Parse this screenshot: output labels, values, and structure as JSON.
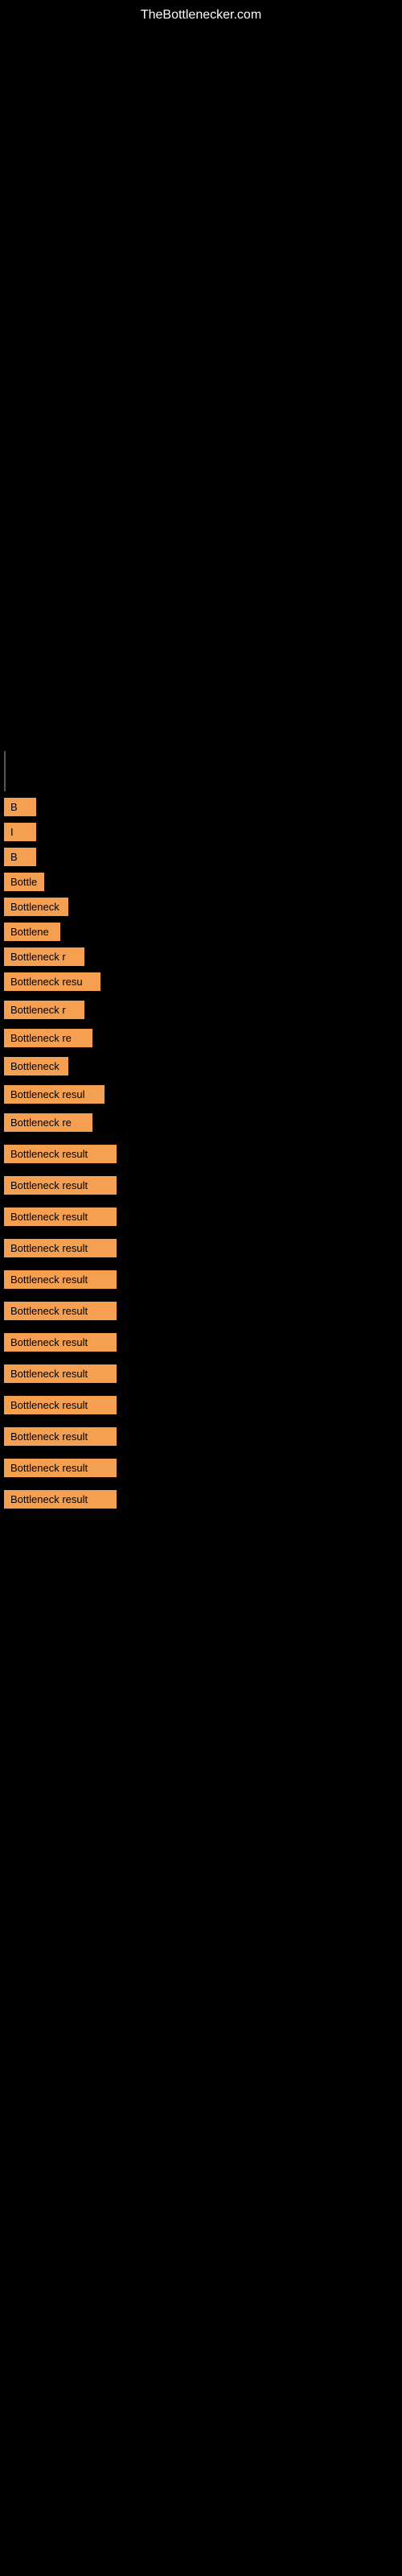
{
  "site": {
    "title": "TheBottlenecker.com"
  },
  "items": [
    {
      "id": 1,
      "label": "B",
      "width": 40
    },
    {
      "id": 2,
      "label": "I",
      "width": 40
    },
    {
      "id": 3,
      "label": "B",
      "width": 40
    },
    {
      "id": 4,
      "label": "Bottle",
      "width": 50
    },
    {
      "id": 5,
      "label": "Bottleneck",
      "width": 80
    },
    {
      "id": 6,
      "label": "Bottlene",
      "width": 70
    },
    {
      "id": 7,
      "label": "Bottleneck r",
      "width": 100
    },
    {
      "id": 8,
      "label": "Bottleneck resu",
      "width": 120
    },
    {
      "id": 9,
      "label": "Bottleneck r",
      "width": 100
    },
    {
      "id": 10,
      "label": "Bottleneck re",
      "width": 110
    },
    {
      "id": 11,
      "label": "Bottleneck",
      "width": 80
    },
    {
      "id": 12,
      "label": "Bottleneck resul",
      "width": 125
    },
    {
      "id": 13,
      "label": "Bottleneck re",
      "width": 110
    },
    {
      "id": 14,
      "label": "Bottleneck result",
      "width": 140
    },
    {
      "id": 15,
      "label": "Bottleneck result",
      "width": 140
    },
    {
      "id": 16,
      "label": "Bottleneck result",
      "width": 140
    },
    {
      "id": 17,
      "label": "Bottleneck result",
      "width": 140
    },
    {
      "id": 18,
      "label": "Bottleneck result",
      "width": 140
    },
    {
      "id": 19,
      "label": "Bottleneck result",
      "width": 140
    },
    {
      "id": 20,
      "label": "Bottleneck result",
      "width": 140
    },
    {
      "id": 21,
      "label": "Bottleneck result",
      "width": 140
    },
    {
      "id": 22,
      "label": "Bottleneck result",
      "width": 140
    },
    {
      "id": 23,
      "label": "Bottleneck result",
      "width": 140
    },
    {
      "id": 24,
      "label": "Bottleneck result",
      "width": 140
    },
    {
      "id": 25,
      "label": "Bottleneck result",
      "width": 140
    }
  ]
}
